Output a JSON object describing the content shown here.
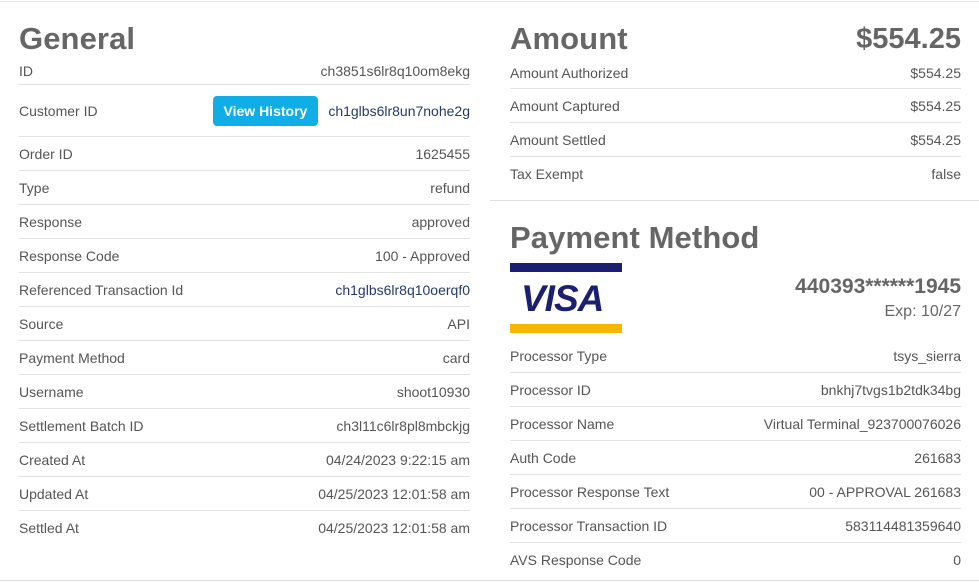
{
  "general": {
    "title": "General",
    "rows": [
      {
        "label": "ID",
        "value": "ch3851s6lr8q10om8ekg"
      },
      {
        "label": "Customer ID",
        "button": "View History",
        "value": "ch1glbs6lr8un7nohe2g"
      },
      {
        "label": "Order ID",
        "value": "1625455"
      },
      {
        "label": "Type",
        "value": "refund"
      },
      {
        "label": "Response",
        "value": "approved"
      },
      {
        "label": "Response Code",
        "value": "100 - Approved"
      },
      {
        "label": "Referenced Transaction Id",
        "value": "ch1glbs6lr8q10oerqf0"
      },
      {
        "label": "Source",
        "value": "API"
      },
      {
        "label": "Payment Method",
        "value": "card"
      },
      {
        "label": "Username",
        "value": "shoot10930"
      },
      {
        "label": "Settlement Batch ID",
        "value": "ch3l11c6lr8pl8mbckjg"
      },
      {
        "label": "Created At",
        "value": "04/24/2023 9:22:15 am"
      },
      {
        "label": "Updated At",
        "value": "04/25/2023 12:01:58 am"
      },
      {
        "label": "Settled At",
        "value": "04/25/2023 12:01:58 am"
      }
    ]
  },
  "amount": {
    "title": "Amount",
    "total": "$554.25",
    "rows": [
      {
        "label": "Amount Authorized",
        "value": "$554.25"
      },
      {
        "label": "Amount Captured",
        "value": "$554.25"
      },
      {
        "label": "Amount Settled",
        "value": "$554.25"
      },
      {
        "label": "Tax Exempt",
        "value": "false"
      }
    ]
  },
  "payment": {
    "title": "Payment Method",
    "card_brand": "VISA",
    "card_number": "440393******1945",
    "card_exp": "Exp: 10/27",
    "rows": [
      {
        "label": "Processor Type",
        "value": "tsys_sierra"
      },
      {
        "label": "Processor ID",
        "value": "bnkhj7tvgs1b2tdk34bg"
      },
      {
        "label": "Processor Name",
        "value": "Virtual Terminal_923700076026"
      },
      {
        "label": "Auth Code",
        "value": "261683"
      },
      {
        "label": "Processor Response Text",
        "value": "00 - APPROVAL 261683"
      },
      {
        "label": "Processor Transaction ID",
        "value": "583114481359640"
      },
      {
        "label": "AVS Response Code",
        "value": "0"
      }
    ]
  },
  "colors": {
    "button_bg": "#0faee6",
    "link_text": "#243a6b",
    "visa_blue": "#1a1f71",
    "visa_gold": "#f7b600"
  }
}
